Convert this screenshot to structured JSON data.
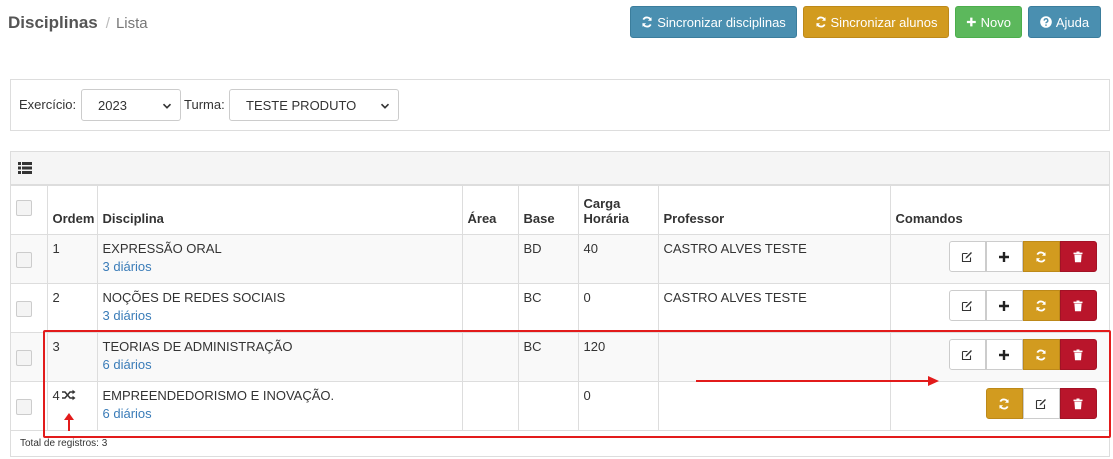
{
  "header": {
    "title": "Disciplinas",
    "separator": "/",
    "subtitle": "Lista",
    "buttons": {
      "sync_disciplinas": "Sincronizar disciplinas",
      "sync_alunos": "Sincronizar alunos",
      "novo": "Novo",
      "ajuda": "Ajuda"
    }
  },
  "filters": {
    "exercicio_label": "Exercício:",
    "exercicio_value": "2023",
    "turma_label": "Turma:",
    "turma_value": "TESTE PRODUTO"
  },
  "table": {
    "columns": [
      "Ordem",
      "Disciplina",
      "Área",
      "Base",
      "Carga Horária",
      "Professor",
      "Comandos"
    ],
    "carga_line1": "Carga",
    "carga_line2": "Horária",
    "rows": [
      {
        "ordem": "1",
        "disciplina": "EXPRESSÃO ORAL",
        "diarios": "3 diários",
        "area": "",
        "base": "BD",
        "carga": "40",
        "professor": "CASTRO ALVES TESTE"
      },
      {
        "ordem": "2",
        "disciplina": "NOÇÕES DE REDES SOCIAIS",
        "diarios": "3 diários",
        "area": "",
        "base": "BC",
        "carga": "0",
        "professor": "CASTRO ALVES TESTE"
      },
      {
        "ordem": "3",
        "disciplina": "TEORIAS DE ADMINISTRAÇÃO",
        "diarios": "6 diários",
        "area": "",
        "base": "BC",
        "carga": "120",
        "professor": ""
      },
      {
        "ordem": "4",
        "disciplina": "EMPREENDEDORISMO E INOVAÇÃO.",
        "diarios": "6 diários",
        "area": "",
        "base": "",
        "carga": "0",
        "professor": ""
      }
    ],
    "total": "Total de registros: 3"
  },
  "colors": {
    "info": "#4a8fb0",
    "warning": "#d29b1f",
    "success": "#5cb85c",
    "danger": "#b9152b",
    "annotation": "#e21b1b",
    "link": "#3a7cb8"
  },
  "icons": [
    "refresh-icon",
    "plus-icon",
    "question-icon",
    "list-icon",
    "edit-icon",
    "trash-icon",
    "shuffle-icon",
    "chevron-down-icon"
  ]
}
